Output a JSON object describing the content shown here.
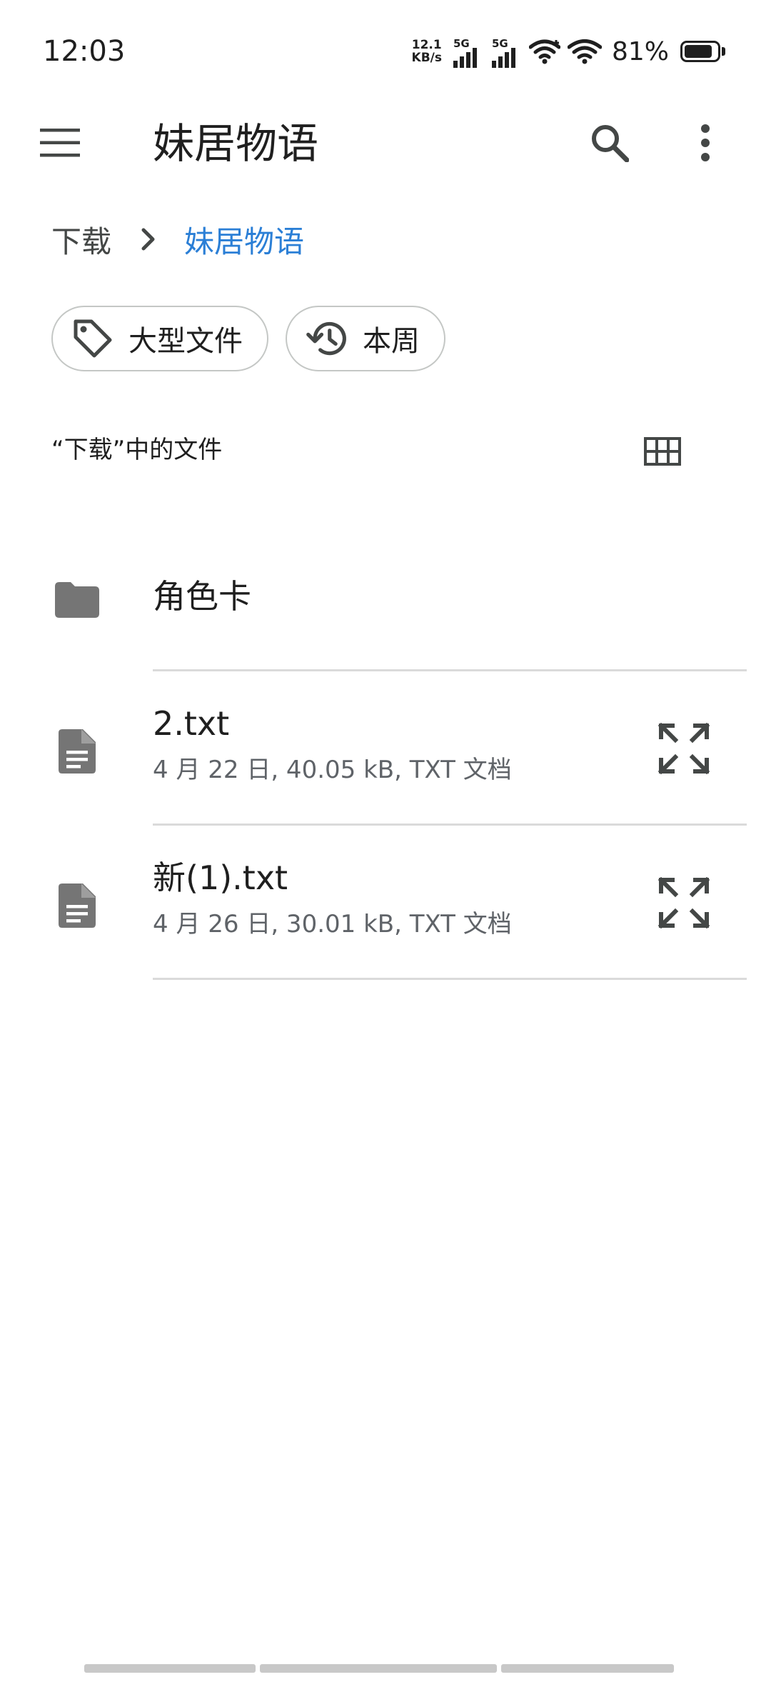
{
  "status_bar": {
    "time": "12:03",
    "net_speed_value": "12.1",
    "net_speed_unit": "KB/s",
    "signal1_label": "5G",
    "signal2_label": "5G",
    "battery_percent": "81%"
  },
  "app_bar": {
    "title": "妹居物语",
    "menu_icon": "hamburger-menu-icon",
    "search_icon": "search-icon",
    "more_icon": "more-vertical-icon"
  },
  "breadcrumb": {
    "root": "下载",
    "current": "妹居物语"
  },
  "chips": [
    {
      "label": "大型文件",
      "icon": "tag-icon"
    },
    {
      "label": "本周",
      "icon": "history-icon"
    }
  ],
  "section": {
    "title": "“下载”中的文件",
    "view_toggle_icon": "grid-view-icon"
  },
  "files": [
    {
      "type": "folder",
      "name": "角色卡"
    },
    {
      "type": "file",
      "name": "2.txt",
      "meta": "4 月 22 日, 40.05 kB, TXT 文档"
    },
    {
      "type": "file",
      "name": "新(1).txt",
      "meta": "4 月 26 日, 30.01 kB, TXT 文档"
    }
  ],
  "colors": {
    "accent": "#2b7fd6",
    "icon_gray": "#757575",
    "text": "#1f1f1f",
    "secondary_text": "#5f6368",
    "divider": "#dadada"
  }
}
